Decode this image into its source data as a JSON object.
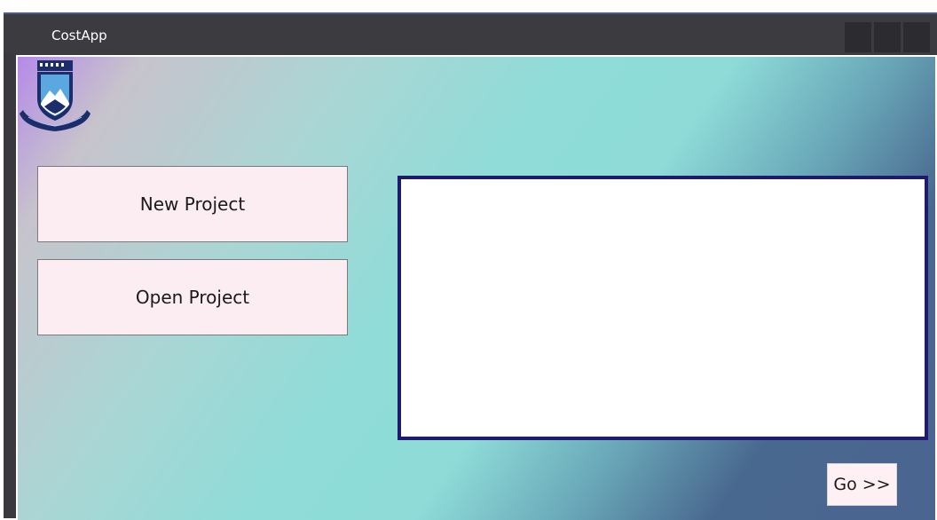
{
  "window": {
    "title": "CostApp"
  },
  "logo": {
    "icon": "crest-logo-icon"
  },
  "buttons": {
    "new_project": "New Project",
    "open_project": "Open Project",
    "go": "Go >>"
  },
  "colors": {
    "titlebar": "#3c3c40",
    "button_bg": "#fcedf2",
    "listbox_border": "#1e1a6e"
  }
}
